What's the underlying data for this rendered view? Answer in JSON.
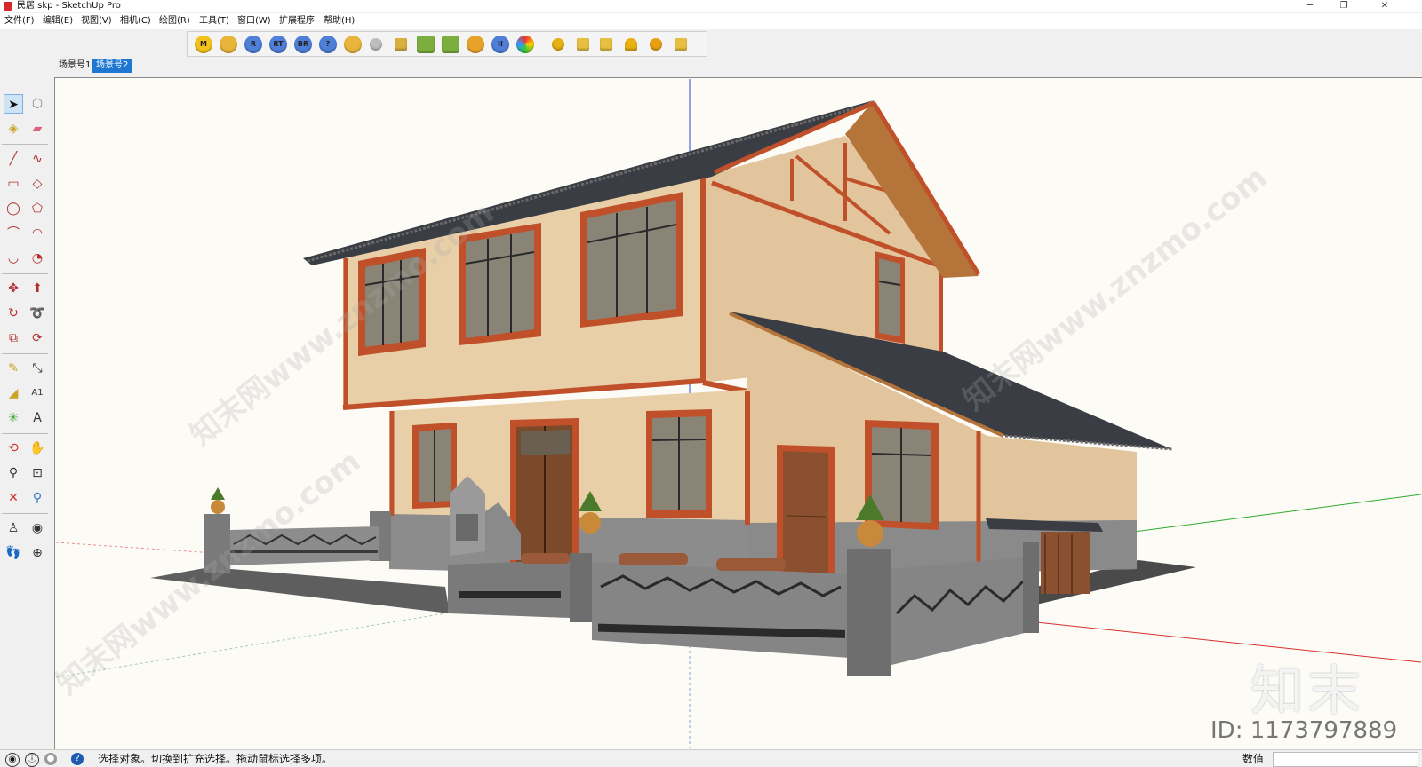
{
  "window": {
    "title": "民居.skp - SketchUp Pro",
    "minimize": "─",
    "restore": "❐",
    "close": "✕"
  },
  "menu": [
    "文件(F)",
    "编辑(E)",
    "视图(V)",
    "相机(C)",
    "绘图(R)",
    "工具(T)",
    "窗口(W)",
    "扩展程序",
    "帮助(H)"
  ],
  "toolbar": {
    "buttons": [
      "M",
      "",
      "R",
      "RT",
      "BR",
      "?",
      "",
      "",
      "",
      "",
      "",
      "",
      "II",
      "",
      "",
      "",
      "",
      "",
      "",
      ""
    ]
  },
  "scene_tabs": [
    "场景号1",
    "场景号2"
  ],
  "status": {
    "message": "选择对象。切换到扩充选择。拖动鼠标选择多项。",
    "measure_label": "数值",
    "measure_value": ""
  },
  "watermark": {
    "logo": "知末",
    "id": "ID: 1173797889",
    "diagonal": "知末网www.znzmo.com"
  },
  "colors": {
    "accent": "#1e78d2",
    "wall": "#e8cfa8",
    "trim": "#c0502a",
    "roof": "#3a3d44",
    "stone": "#8c8c8c"
  }
}
